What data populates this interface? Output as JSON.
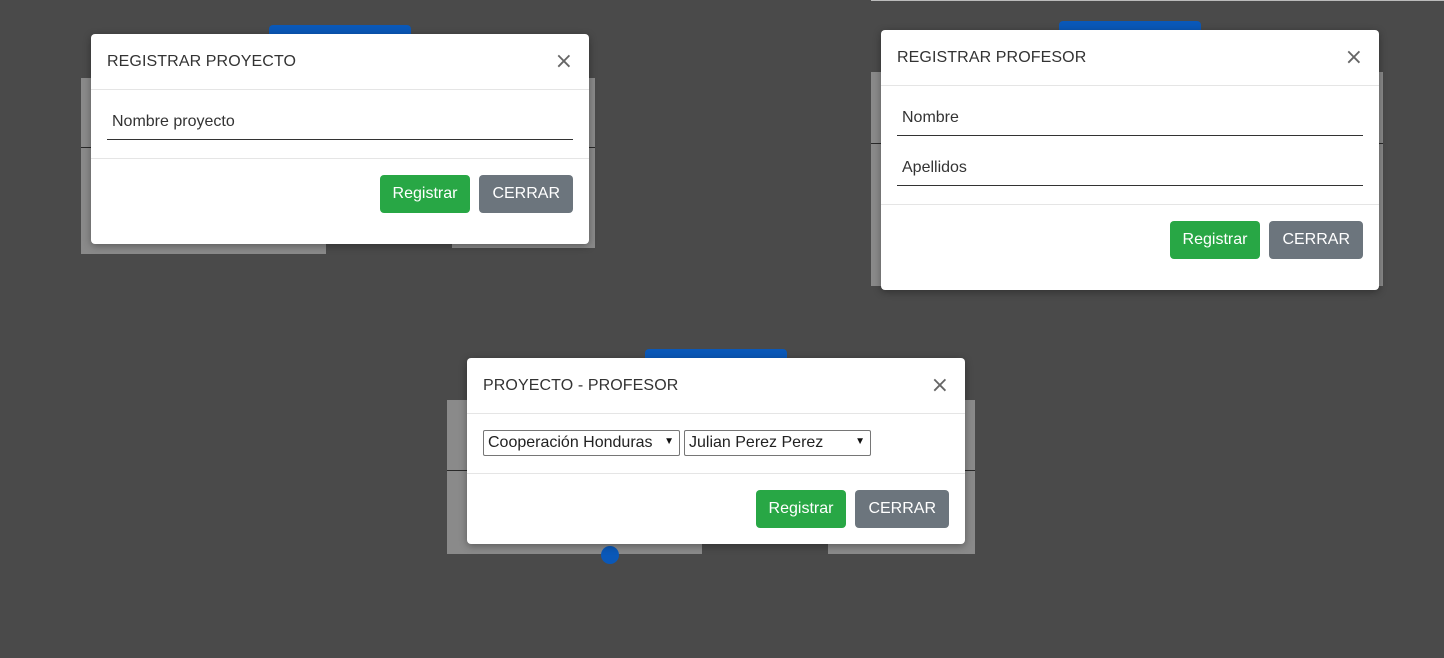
{
  "modal_proyecto": {
    "title": "REGISTRAR PROYECTO",
    "close": "×",
    "fields": {
      "nombre_placeholder": "Nombre proyecto"
    },
    "register_label": "Registrar",
    "close_label": "CERRAR"
  },
  "modal_profesor": {
    "title": "REGISTRAR PROFESOR",
    "close": "×",
    "fields": {
      "nombre_placeholder": "Nombre",
      "apellidos_placeholder": "Apellidos"
    },
    "register_label": "Registrar",
    "close_label": "CERRAR"
  },
  "modal_proyecto_profesor": {
    "title": "PROYECTO - PROFESOR",
    "close": "×",
    "proyecto_select": {
      "value": "Cooperación Honduras",
      "caret": "▼"
    },
    "profesor_select": {
      "value": "Julian Perez Perez",
      "caret": "▼"
    },
    "register_label": "Registrar",
    "close_label": "CERRAR"
  },
  "colors": {
    "success": "#28a745",
    "secondary": "#6c757d",
    "backdrop": "#4a4a4a"
  }
}
